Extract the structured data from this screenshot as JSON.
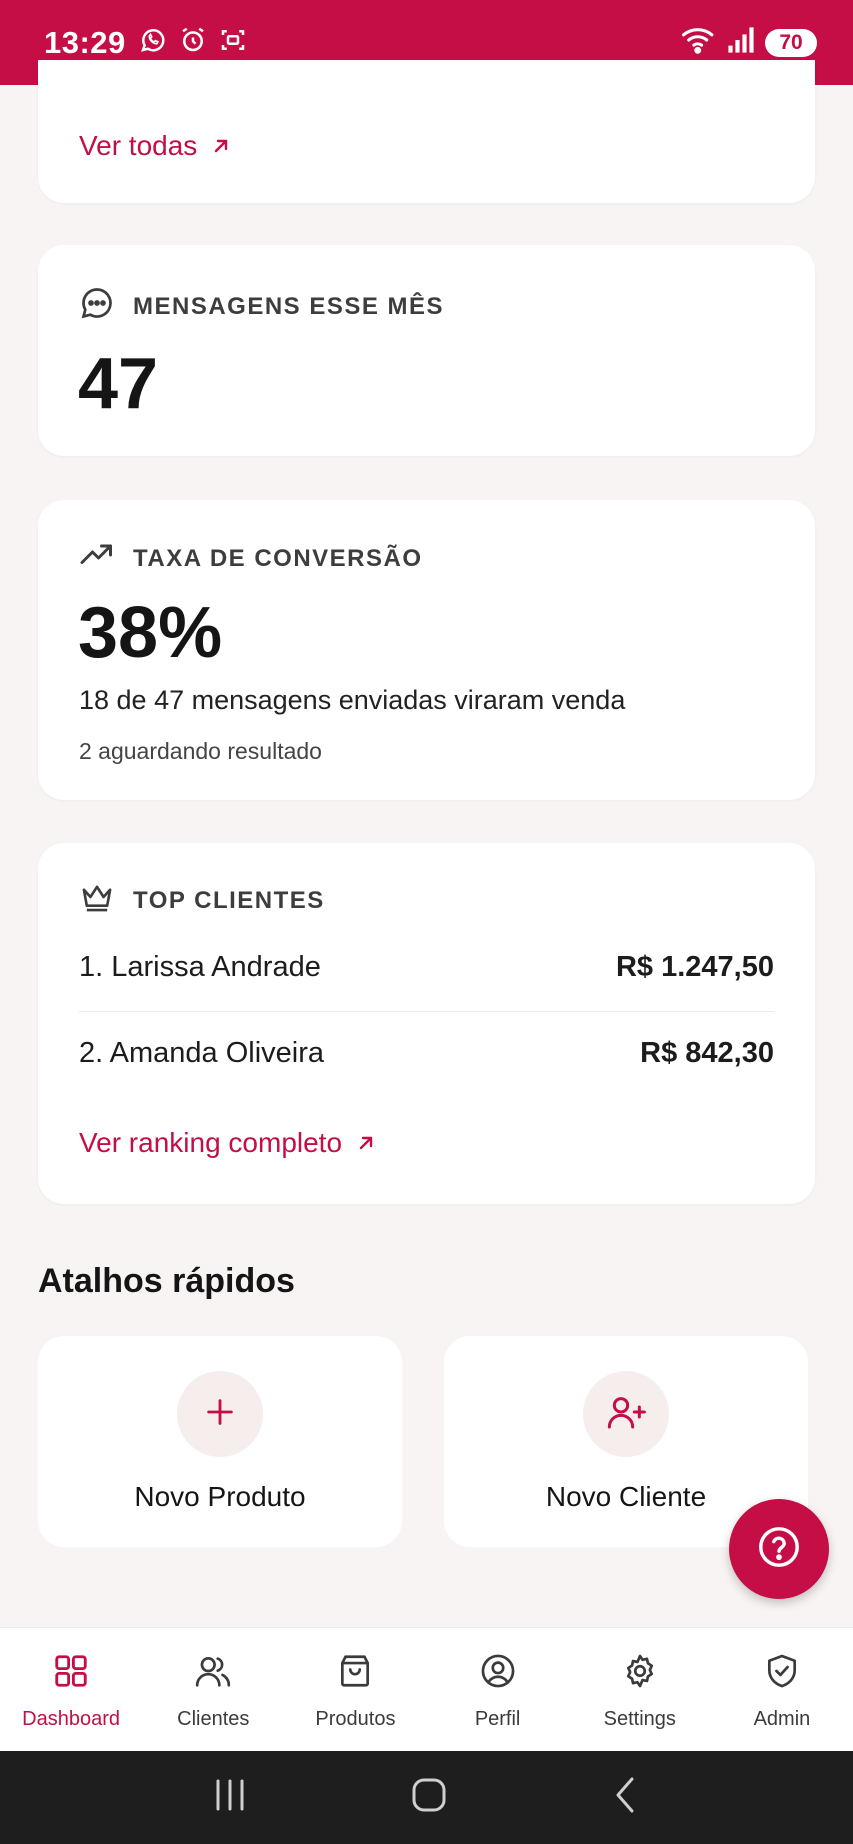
{
  "status_bar": {
    "time": "13:29",
    "battery": "70",
    "background_color": "#c40e45",
    "icons": [
      "whatsapp-icon",
      "alarm-icon",
      "screenshot-icon",
      "wifi-icon",
      "signal-icon",
      "battery-icon"
    ]
  },
  "top_card": {
    "link_label": "Ver todas"
  },
  "messages_card": {
    "title": "MENSAGENS ESSE MÊS",
    "value": "47",
    "icon": "chat-bubble-icon"
  },
  "conversion_card": {
    "title": "TAXA DE CONVERSÃO",
    "value": "38%",
    "subtitle": "18 de 47 mensagens enviadas viraram venda",
    "note": "2 aguardando resultado",
    "icon": "trending-up-icon"
  },
  "top_clients_card": {
    "title": "TOP CLIENTES",
    "icon": "crown-icon",
    "clients": [
      {
        "name": "1. Larissa Andrade",
        "value": "R$ 1.247,50"
      },
      {
        "name": "2. Amanda Oliveira",
        "value": "R$ 842,30"
      }
    ],
    "link_label": "Ver ranking completo"
  },
  "shortcuts": {
    "title": "Atalhos rápidos",
    "items": [
      {
        "label": "Novo Produto",
        "icon": "plus-icon"
      },
      {
        "label": "Novo Cliente",
        "icon": "user-plus-icon"
      }
    ]
  },
  "fab": {
    "icon": "help-icon"
  },
  "bottom_nav": {
    "items": [
      {
        "label": "Dashboard",
        "icon": "dashboard-icon",
        "active": true
      },
      {
        "label": "Clientes",
        "icon": "users-icon"
      },
      {
        "label": "Produtos",
        "icon": "shopping-bag-icon"
      },
      {
        "label": "Perfil",
        "icon": "user-circle-icon"
      },
      {
        "label": "Settings",
        "icon": "gear-icon"
      },
      {
        "label": "Admin",
        "icon": "shield-check-icon"
      }
    ]
  },
  "colors": {
    "accent": "#c40e45",
    "background": "#f8f4f4",
    "card": "#ffffff"
  }
}
